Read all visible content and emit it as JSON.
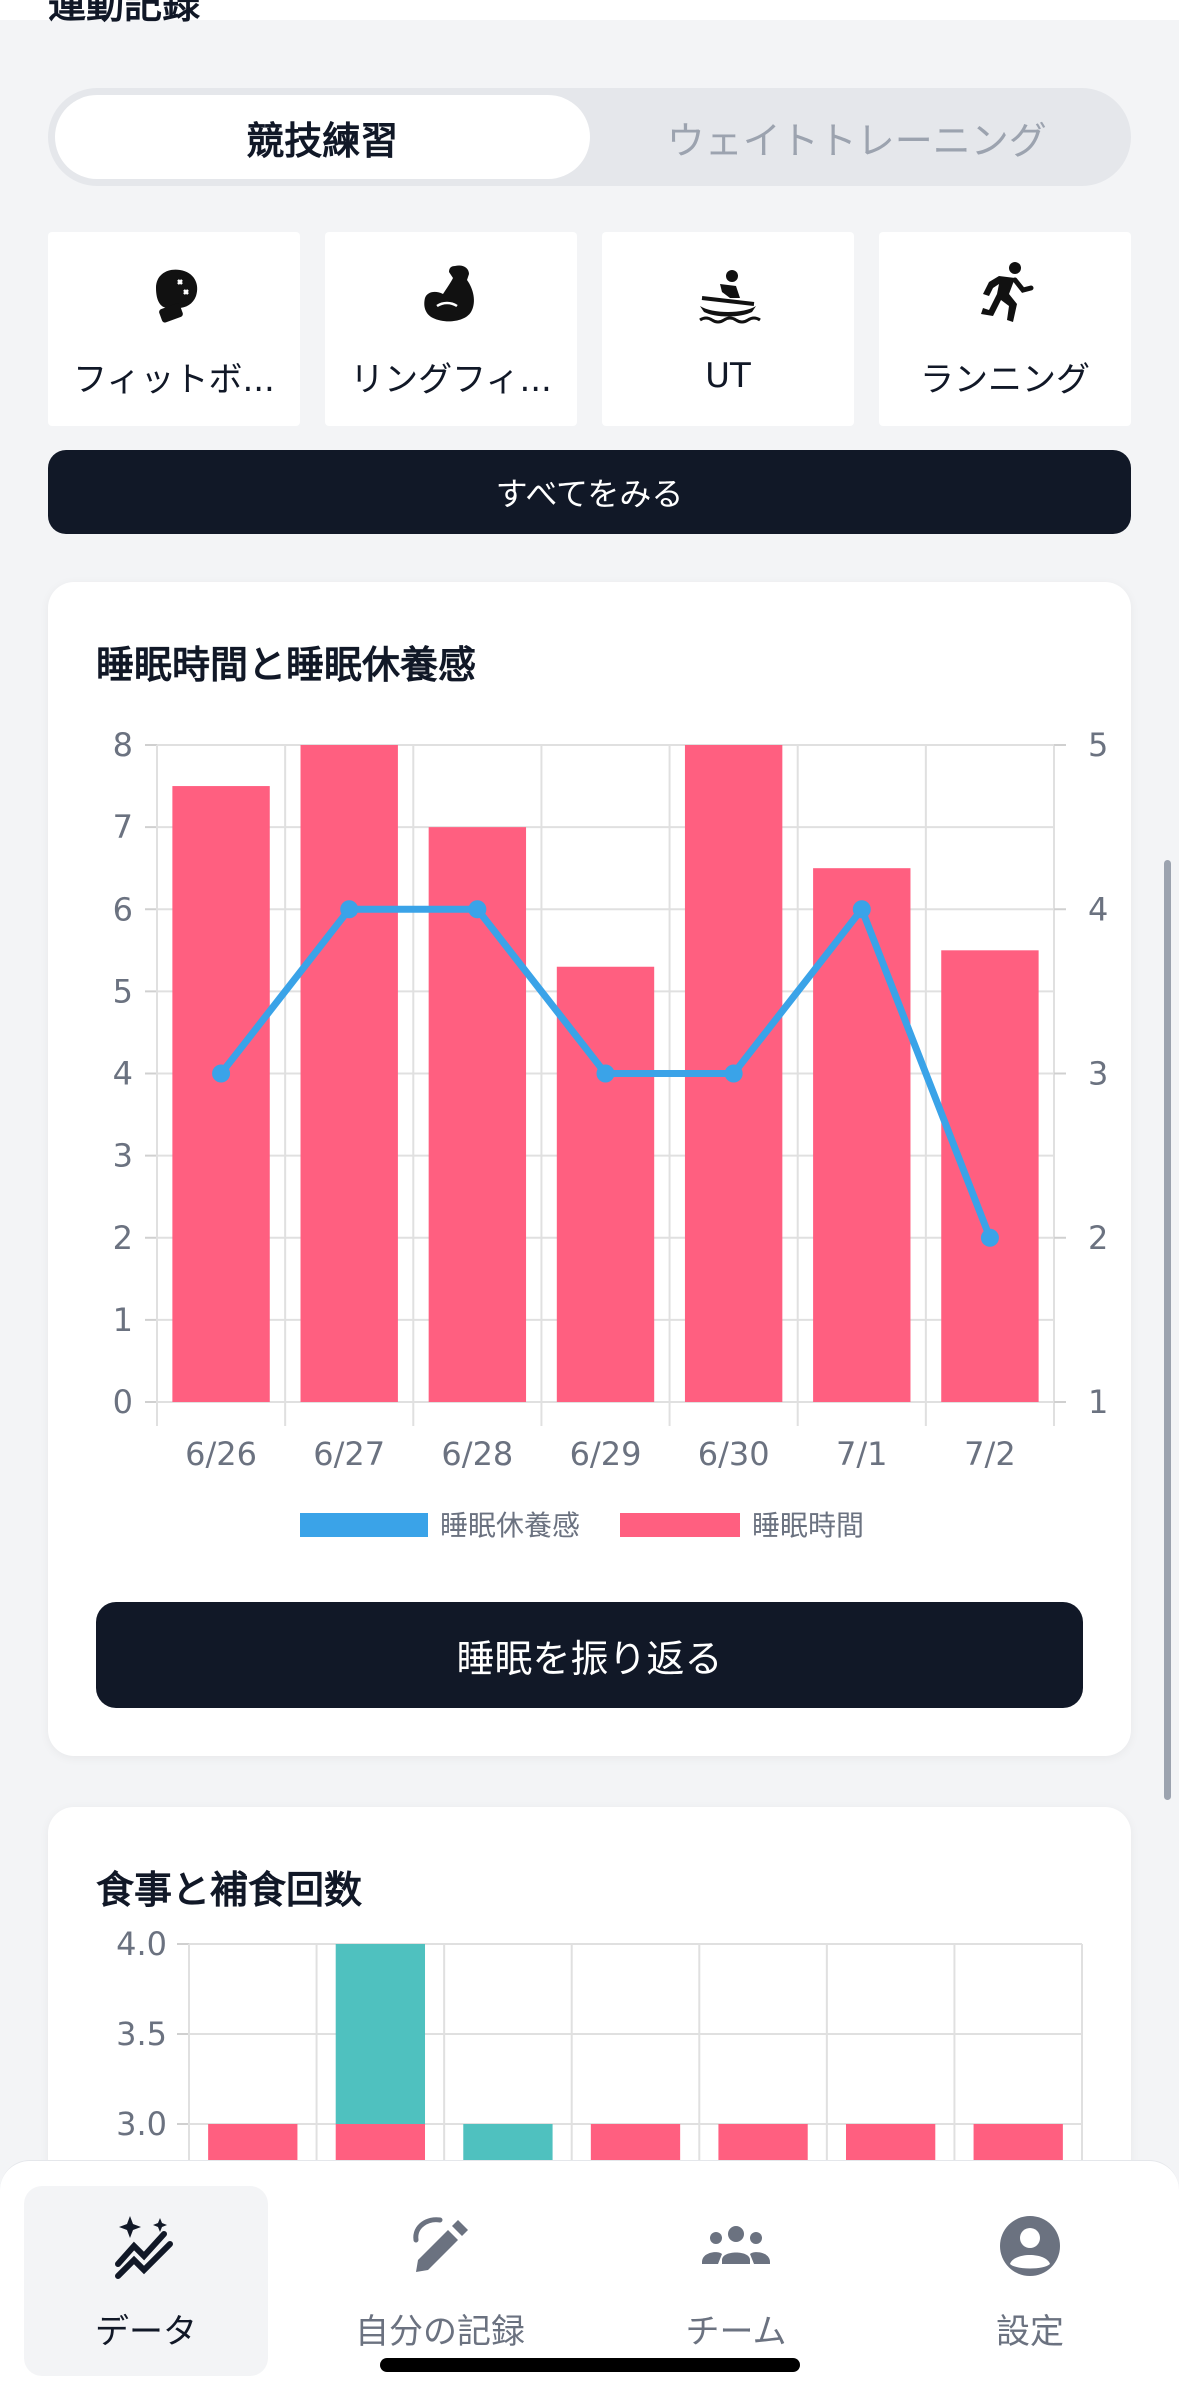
{
  "section": {
    "title": "運動記録"
  },
  "segment": {
    "tabs": [
      {
        "label": "競技練習",
        "active": true
      },
      {
        "label": "ウェイトトレーニング",
        "active": false
      }
    ]
  },
  "activities": [
    {
      "label": "フィットボ...",
      "icon": "boxing-glove-icon"
    },
    {
      "label": "リングフィ...",
      "icon": "flexed-biceps-icon"
    },
    {
      "label": "UT",
      "icon": "rowing-icon"
    },
    {
      "label": "ランニング",
      "icon": "running-icon"
    }
  ],
  "see_all_label": "すべてをみる",
  "sleep_card": {
    "title": "睡眠時間と睡眠休養感",
    "button_label": "睡眠を振り返る"
  },
  "meal_card": {
    "title": "食事と補食回数"
  },
  "colors": {
    "primary_dark": "#111827",
    "bar_pink": "#ff5f80",
    "line_blue": "#3aa3e8",
    "teal": "#4fc1bf"
  },
  "chart_data": [
    {
      "type": "bar+line",
      "title": "睡眠時間と睡眠休養感",
      "categories": [
        "6/26",
        "6/27",
        "6/28",
        "6/29",
        "6/30",
        "7/1",
        "7/2"
      ],
      "series": [
        {
          "name": "睡眠時間",
          "type": "bar",
          "axis": "left",
          "values": [
            7.5,
            8,
            7,
            5.3,
            8,
            6.5,
            5.5
          ]
        },
        {
          "name": "睡眠休養感",
          "type": "line",
          "axis": "right",
          "values": [
            3,
            4,
            4,
            3,
            3,
            4,
            2
          ]
        }
      ],
      "y_left": {
        "range": [
          0,
          8
        ],
        "ticks": [
          "0",
          "1",
          "2",
          "3",
          "4",
          "5",
          "6",
          "7",
          "8"
        ]
      },
      "y_right": {
        "range": [
          1,
          5
        ],
        "ticks": [
          "1",
          "2",
          "3",
          "4",
          "5"
        ]
      },
      "legend": [
        "睡眠休養感",
        "睡眠時間"
      ],
      "legend_position": "bottom",
      "grid": true
    },
    {
      "type": "bar",
      "title": "食事と補食回数",
      "stacked": true,
      "visible_y_ticks": [
        "4.0",
        "3.5",
        "3.0"
      ],
      "ylim_visible": [
        2.65,
        4.0
      ],
      "columns": 7,
      "series": [
        {
          "color": "pink",
          "values": [
            3,
            3,
            0,
            3,
            3,
            3,
            3
          ]
        },
        {
          "color": "teal",
          "values": [
            0,
            1,
            3,
            0,
            0,
            0,
            0
          ]
        }
      ],
      "grid": true
    }
  ],
  "bottom_nav": {
    "items": [
      {
        "label": "データ",
        "icon": "chart-sparkle-icon",
        "active": true
      },
      {
        "label": "自分の記録",
        "icon": "edit-pencil-icon",
        "active": false
      },
      {
        "label": "チーム",
        "icon": "group-icon",
        "active": false
      },
      {
        "label": "設定",
        "icon": "user-circle-icon",
        "active": false
      }
    ]
  }
}
